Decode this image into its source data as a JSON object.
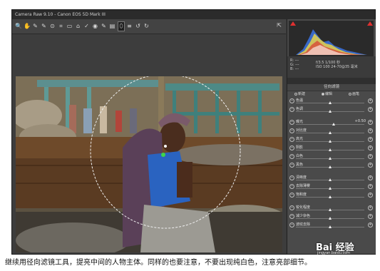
{
  "window": {
    "title": "Camera Raw 9.10 - Canon EOS 5D Mark III"
  },
  "toolbar": {
    "tools": [
      {
        "name": "zoom-tool",
        "icon": "🔍"
      },
      {
        "name": "hand-tool",
        "icon": "✋"
      },
      {
        "name": "white-balance-tool",
        "icon": "✎"
      },
      {
        "name": "color-sampler-tool",
        "icon": "✎"
      },
      {
        "name": "targeted-adjustment-tool",
        "icon": "⊙"
      },
      {
        "name": "crop-tool",
        "icon": "⌗"
      },
      {
        "name": "straighten-tool",
        "icon": "▭"
      },
      {
        "name": "transform-tool",
        "icon": "⌂"
      },
      {
        "name": "spot-removal-tool",
        "icon": "✓"
      },
      {
        "name": "red-eye-tool",
        "icon": "◉"
      },
      {
        "name": "adjustment-brush-tool",
        "icon": "✎"
      },
      {
        "name": "graduated-filter-tool",
        "icon": "▤"
      },
      {
        "name": "radial-filter-tool",
        "icon": "⬯"
      },
      {
        "name": "preferences-tool",
        "icon": "≡"
      },
      {
        "name": "rotate-ccw-tool",
        "icon": "↺"
      },
      {
        "name": "rotate-cw-tool",
        "icon": "↻"
      }
    ],
    "right_icon": "⇱"
  },
  "info": {
    "rgb_r": "R: ---",
    "rgb_g": "G: ---",
    "rgb_b": "B: ---",
    "exposure_line": "f/3.5  1/100 秒",
    "iso_line": "ISO 100  24-70@35 毫米"
  },
  "panel": {
    "title": "径向滤镜",
    "modes": [
      "新建",
      "编辑",
      "画笔"
    ],
    "selected_mode": 1
  },
  "sliders": [
    {
      "label": "色温",
      "value": "",
      "pos": 0.5
    },
    {
      "label": "色调",
      "value": "",
      "pos": 0.5
    },
    {
      "label": "曝光",
      "value": "+0.50",
      "pos": 0.55
    },
    {
      "label": "对比度",
      "value": "",
      "pos": 0.5
    },
    {
      "label": "高光",
      "value": "",
      "pos": 0.5
    },
    {
      "label": "阴影",
      "value": "",
      "pos": 0.5
    },
    {
      "label": "白色",
      "value": "",
      "pos": 0.5
    },
    {
      "label": "黑色",
      "value": "",
      "pos": 0.5
    },
    {
      "label": "清晰度",
      "value": "",
      "pos": 0.5
    },
    {
      "label": "去除薄雾",
      "value": "",
      "pos": 0.5
    },
    {
      "label": "饱和度",
      "value": "",
      "pos": 0.5
    },
    {
      "label": "锐化程度",
      "value": "",
      "pos": 0.5
    },
    {
      "label": "减少杂色",
      "value": "",
      "pos": 0.5
    },
    {
      "label": "波纹去除",
      "value": "",
      "pos": 0.5
    }
  ],
  "caption": "继续用径向滤镜工具，提亮中间的人物主体。同样的也要注意，不要出现纯白色，注意亮部细节。",
  "watermark": {
    "brand": "Bai 经验",
    "url": "jingyan.baidu.com"
  }
}
